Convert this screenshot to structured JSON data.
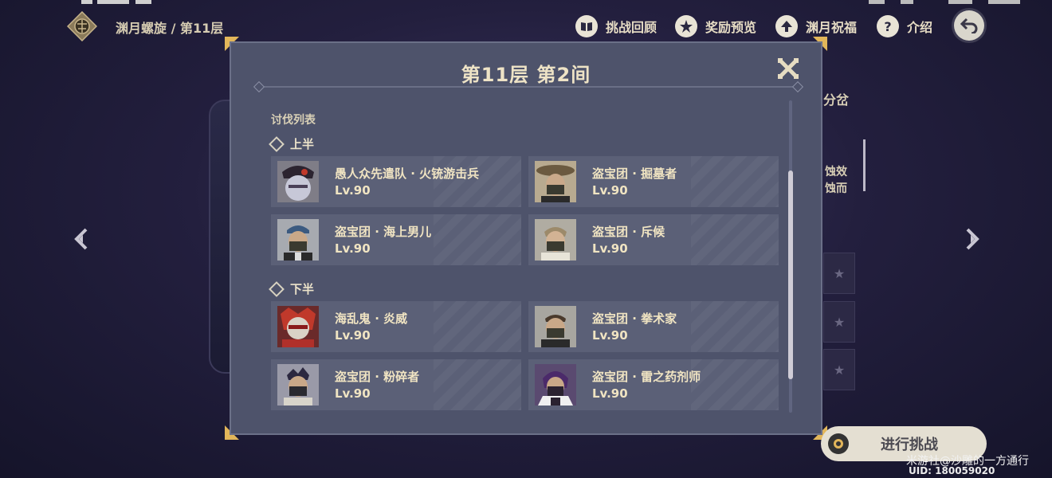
{
  "breadcrumb": "渊月螺旋 / 第11层",
  "top_menu": [
    {
      "label": "挑战回顾",
      "icon": "book-icon"
    },
    {
      "label": "奖励预览",
      "icon": "star-badge-icon"
    },
    {
      "label": "渊月祝福",
      "icon": "up-arrow-icon"
    },
    {
      "label": "介绍",
      "icon": "question-icon"
    }
  ],
  "background": {
    "right_title": "分岔",
    "right_text_1": "蚀效",
    "right_text_2": "蚀而"
  },
  "dialog": {
    "title": "第11层 第2间",
    "section_label": "讨伐列表",
    "first_half_label": "上半",
    "second_half_label": "下半",
    "first_half": [
      {
        "name": "愚人众先遣队 · 火铳游击兵",
        "level": "Lv.90",
        "portrait": "fatui-skirmisher-pyro"
      },
      {
        "name": "盗宝团 · 掘墓者",
        "level": "Lv.90",
        "portrait": "treasure-hoarder-gravedigger"
      },
      {
        "name": "盗宝团 · 海上男儿",
        "level": "Lv.90",
        "portrait": "treasure-hoarder-seaman"
      },
      {
        "name": "盗宝团 · 斥候",
        "level": "Lv.90",
        "portrait": "treasure-hoarder-scout"
      }
    ],
    "second_half": [
      {
        "name": "海乱鬼 · 炎威",
        "level": "Lv.90",
        "portrait": "nobushi-kairagi-fiery"
      },
      {
        "name": "盗宝团 · 拳术家",
        "level": "Lv.90",
        "portrait": "treasure-hoarder-pugilist"
      },
      {
        "name": "盗宝团 · 粉碎者",
        "level": "Lv.90",
        "portrait": "treasure-hoarder-crusher"
      },
      {
        "name": "盗宝团 · 雷之药剂师",
        "level": "Lv.90",
        "portrait": "treasure-hoarder-electro-potioneer"
      }
    ]
  },
  "challenge_button": "进行挑战",
  "watermark": "米游社@沙雕的一方通行",
  "uid": "UID: 180059020",
  "colors": {
    "accent_gold": "#e2b65a",
    "dialog_bg": "#4e536b",
    "card_bg": "#5b6077",
    "text_cream": "#f0e4c2"
  }
}
